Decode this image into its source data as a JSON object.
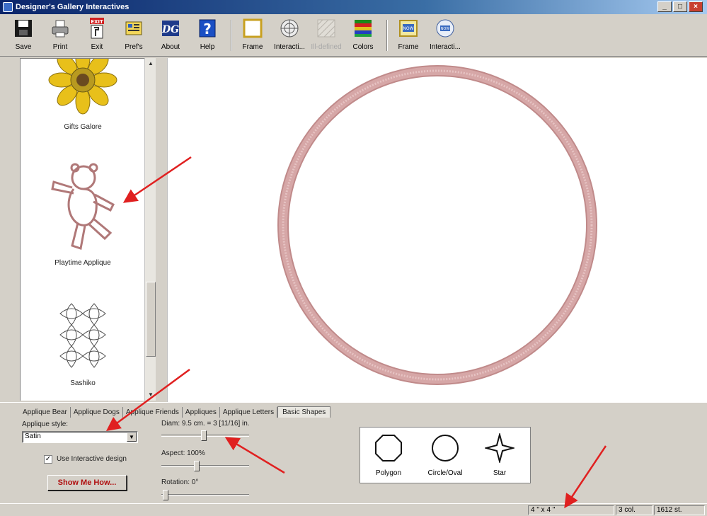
{
  "window": {
    "title": "Designer's Gallery Interactives"
  },
  "toolbar": {
    "items": [
      {
        "label": "Save",
        "icon": "save-icon"
      },
      {
        "label": "Print",
        "icon": "print-icon"
      },
      {
        "label": "Exit",
        "icon": "exit-icon",
        "badge": "EXIT"
      },
      {
        "label": "Pref's",
        "icon": "preferences-icon"
      },
      {
        "label": "About",
        "icon": "about-icon"
      },
      {
        "label": "Help",
        "icon": "help-icon"
      },
      {
        "label": "Frame",
        "icon": "frame-icon"
      },
      {
        "label": "Interacti...",
        "icon": "interactive-icon"
      },
      {
        "label": "Ill-defined",
        "icon": "disabled-pattern-icon",
        "disabled": true
      },
      {
        "label": "Colors",
        "icon": "colors-icon"
      },
      {
        "label": "Frame",
        "icon": "now-frame-icon"
      },
      {
        "label": "Interacti...",
        "icon": "now-interactive-icon"
      }
    ]
  },
  "gallery": {
    "items": [
      {
        "caption": "Gifts Galore"
      },
      {
        "caption": "Playtime Applique"
      },
      {
        "caption": "Sashiko"
      }
    ]
  },
  "tabs": [
    {
      "label": "Applique Bear"
    },
    {
      "label": "Applique Dogs"
    },
    {
      "label": "Applique Friends"
    },
    {
      "label": "Appliques"
    },
    {
      "label": "Applique Letters"
    },
    {
      "label": "Basic Shapes",
      "active": true
    }
  ],
  "controls": {
    "style_label": "Applique style:",
    "style_value": "Satin",
    "use_interactive_label": "Use Interactive design",
    "use_interactive_checked": true,
    "show_me_how": "Show Me How...",
    "diam_label": "Diam: 9.5 cm. = 3 [11/16] in.",
    "diam_level": 0.48,
    "aspect_label": "Aspect: 100%",
    "aspect_level": 0.4,
    "rotation_label": "Rotation: 0°",
    "rotation_level": 0.02
  },
  "shapes": [
    {
      "label": "Polygon",
      "icon": "octagon-icon"
    },
    {
      "label": "Circle/Oval",
      "icon": "circle-icon"
    },
    {
      "label": "Star",
      "icon": "star-icon"
    }
  ],
  "status": {
    "hoop": "4 \" x 4 \"",
    "colors": "3 col.",
    "stitches": "1612 st."
  },
  "colors": {
    "ring": "#d6a7a7",
    "ring_dark": "#c08a8a",
    "annotation_arrow": "#e02020"
  }
}
